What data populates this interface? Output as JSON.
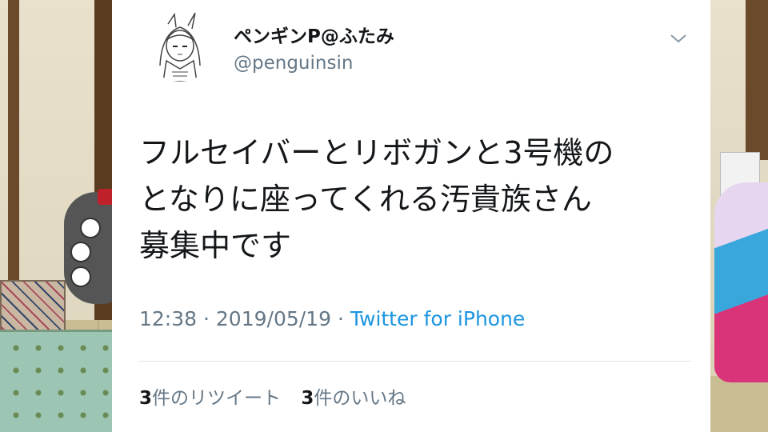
{
  "tweet": {
    "display_name": "ペンギンP@ふたみ",
    "handle": "@penguinsin",
    "text_lines": [
      "フルセイバーとリボガンと3号機の",
      "となりに座ってくれる汚貴族さん",
      "募集中です"
    ],
    "time": "12:38",
    "date": "2019/05/19",
    "separator": "·",
    "source": "Twitter for iPhone",
    "retweet_count": "3",
    "retweet_label": "件のリツイート",
    "like_count": "3",
    "like_label": "件のいいね"
  },
  "icons": {
    "menu": "chevron-down-icon",
    "avatar": "avatar-drawing"
  },
  "colors": {
    "text": "#14171a",
    "secondary": "#657786",
    "link": "#1b95e0",
    "card_bg": "#ffffff"
  }
}
